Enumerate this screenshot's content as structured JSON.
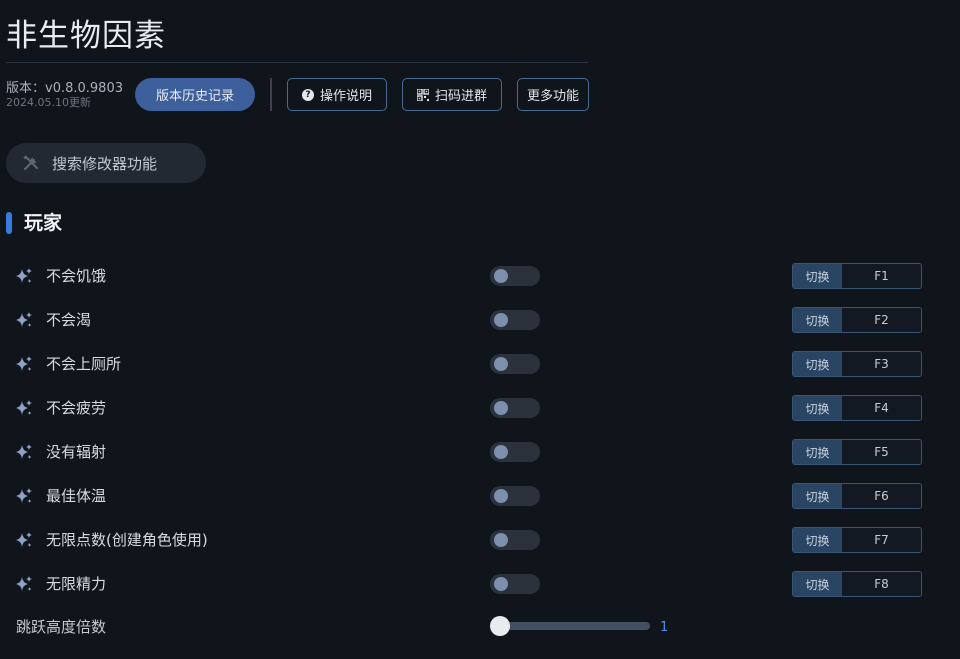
{
  "app": {
    "title": "非生物因素",
    "version": "版本：v0.8.0.9803",
    "updated": "2024.05.10更新"
  },
  "toolbar": {
    "history_label": "版本历史记录",
    "help_label": "操作说明",
    "qr_label": "扫码进群",
    "more_label": "更多功能"
  },
  "search": {
    "placeholder": "搜索修改器功能"
  },
  "section": {
    "title": "玩家"
  },
  "cheats": [
    {
      "label": "不会饥饿",
      "switch_label": "切换",
      "hotkey": "F1",
      "enabled": false
    },
    {
      "label": "不会渴",
      "switch_label": "切换",
      "hotkey": "F2",
      "enabled": false
    },
    {
      "label": "不会上厕所",
      "switch_label": "切换",
      "hotkey": "F3",
      "enabled": false
    },
    {
      "label": "不会疲劳",
      "switch_label": "切换",
      "hotkey": "F4",
      "enabled": false
    },
    {
      "label": "没有辐射",
      "switch_label": "切换",
      "hotkey": "F5",
      "enabled": false
    },
    {
      "label": "最佳体温",
      "switch_label": "切换",
      "hotkey": "F6",
      "enabled": false
    },
    {
      "label": "无限点数(创建角色使用)",
      "switch_label": "切换",
      "hotkey": "F7",
      "enabled": false
    },
    {
      "label": "无限精力",
      "switch_label": "切换",
      "hotkey": "F8",
      "enabled": false
    }
  ],
  "slider": {
    "label": "跳跃高度倍数",
    "value": "1"
  },
  "colors": {
    "background": "#10151c",
    "accent": "#3a7be0",
    "primary_button": "#3d5f9b",
    "slider_value": "#4f8ee8"
  },
  "icons": {
    "help": "question-circle-icon",
    "qr": "qr-grid-icon",
    "search": "tools-icon",
    "cheat": "sparkle-icon"
  }
}
